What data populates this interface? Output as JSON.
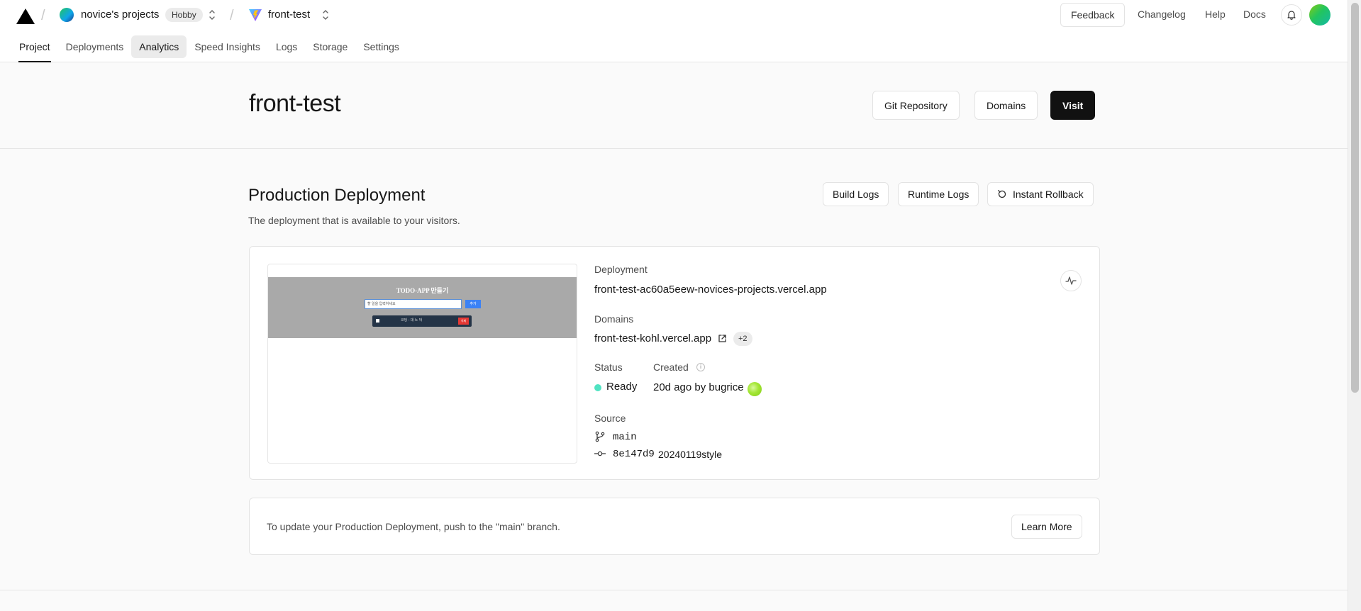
{
  "header": {
    "team_name": "novice's projects",
    "plan_badge": "Hobby",
    "project_name": "front-test",
    "feedback": "Feedback",
    "links": [
      "Changelog",
      "Help",
      "Docs"
    ]
  },
  "tabs": [
    {
      "label": "Project",
      "active": true
    },
    {
      "label": "Deployments"
    },
    {
      "label": "Analytics"
    },
    {
      "label": "Speed Insights"
    },
    {
      "label": "Logs"
    },
    {
      "label": "Storage"
    },
    {
      "label": "Settings"
    }
  ],
  "hero": {
    "title": "front-test",
    "git_repository": "Git Repository",
    "domains": "Domains",
    "visit": "Visit"
  },
  "production": {
    "title": "Production Deployment",
    "subtitle": "The deployment that is available to your visitors.",
    "build_logs": "Build Logs",
    "runtime_logs": "Runtime Logs",
    "instant_rollback": "Instant Rollback",
    "preview": {
      "title": "TODO-APP 만들기",
      "input_placeholder": "할 일을 입력하세요",
      "add_button": "추가",
      "item_text": "코딩 - 대 노 덕",
      "delete_button": "삭제"
    },
    "deployment_label": "Deployment",
    "deployment_url": "front-test-ac60a5eew-novices-projects.vercel.app",
    "domains_label": "Domains",
    "domain_url": "front-test-kohl.vercel.app",
    "domains_extra": "+2",
    "status_label": "Status",
    "status_value": "Ready",
    "created_label": "Created",
    "created_value": "20d ago by bugrice",
    "source_label": "Source",
    "branch": "main",
    "commit_hash": "8e147d9",
    "commit_message": "20240119style"
  },
  "info": {
    "text": "To update your Production Deployment, push to the \"main\" branch.",
    "learn_more": "Learn More"
  },
  "colors": {
    "accent_dark": "#111111",
    "status_ready": "#50e3c2",
    "border": "#e3e3e3",
    "page_bg": "#fafafa"
  }
}
